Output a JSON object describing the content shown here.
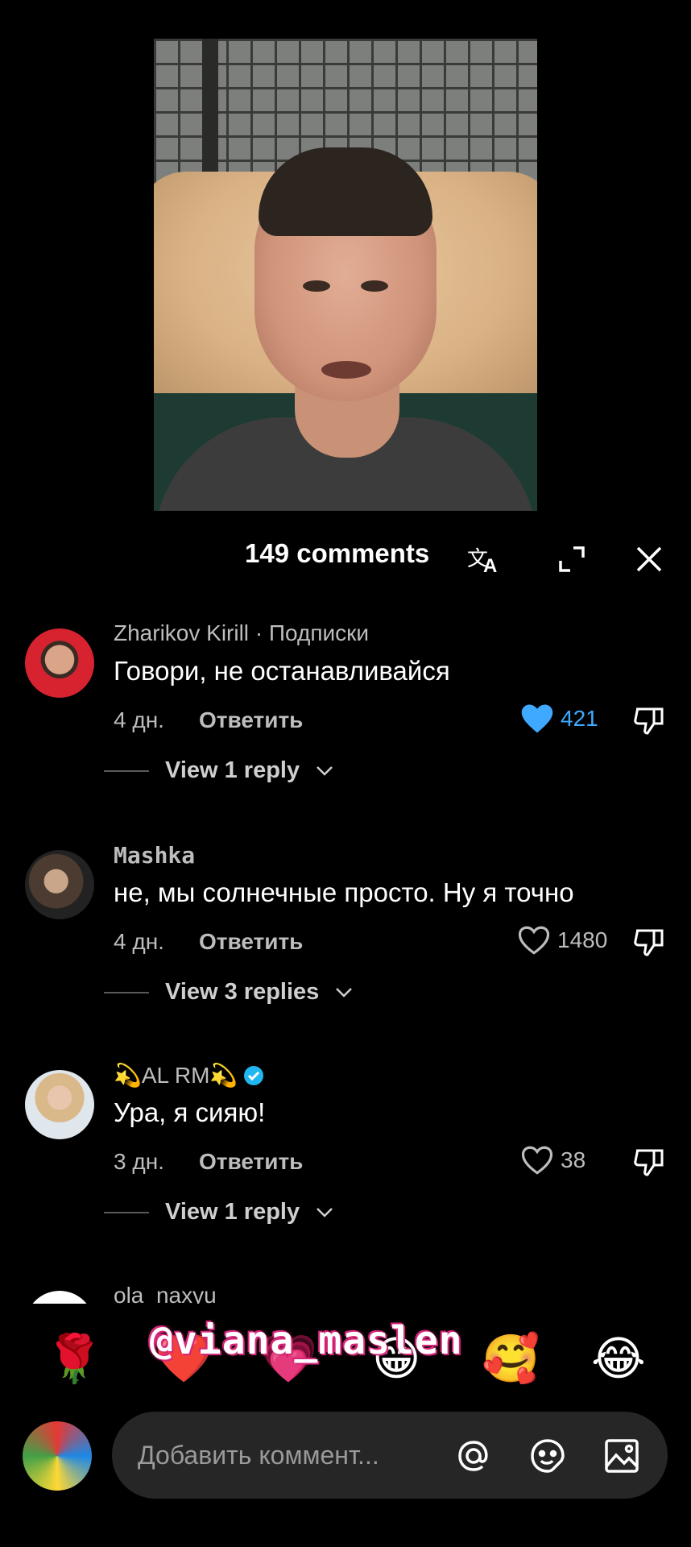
{
  "header": {
    "comments_count_label": "149 comments"
  },
  "comments": [
    {
      "author": "Zharikov Kirill",
      "subscription_label": "· Подписки",
      "text": "Говори, не останавливайся",
      "time": "4 дн.",
      "reply_label": "Ответить",
      "likes": "421",
      "liked": true,
      "view_replies": "View 1 reply"
    },
    {
      "author": "Mashka",
      "text": "не, мы солнечные просто. Ну я точно",
      "time": "4 дн.",
      "reply_label": "Ответить",
      "likes": "1480",
      "liked": false,
      "view_replies": "View 3 replies"
    },
    {
      "author": "💫AL RM💫",
      "verified": true,
      "text": "Ура, я сияю!",
      "time": "3 дн.",
      "reply_label": "Ответить",
      "likes": "38",
      "liked": false,
      "view_replies": "View 1 reply"
    },
    {
      "author": "ola_naxyu"
    }
  ],
  "reactions": [
    "🌹",
    "❤️",
    "💗",
    "😁",
    "🥰",
    "😂"
  ],
  "watermark": "@viana_maslen",
  "composer": {
    "placeholder": "Добавить коммент..."
  },
  "colors": {
    "like_active": "#3fa9ff",
    "background": "#000000",
    "input_bg": "#262626"
  },
  "icons": [
    "translate-icon",
    "expand-icon",
    "close-icon",
    "heart-icon",
    "dislike-icon",
    "mention-icon",
    "sticker-icon",
    "image-icon",
    "verified-badge-icon"
  ]
}
